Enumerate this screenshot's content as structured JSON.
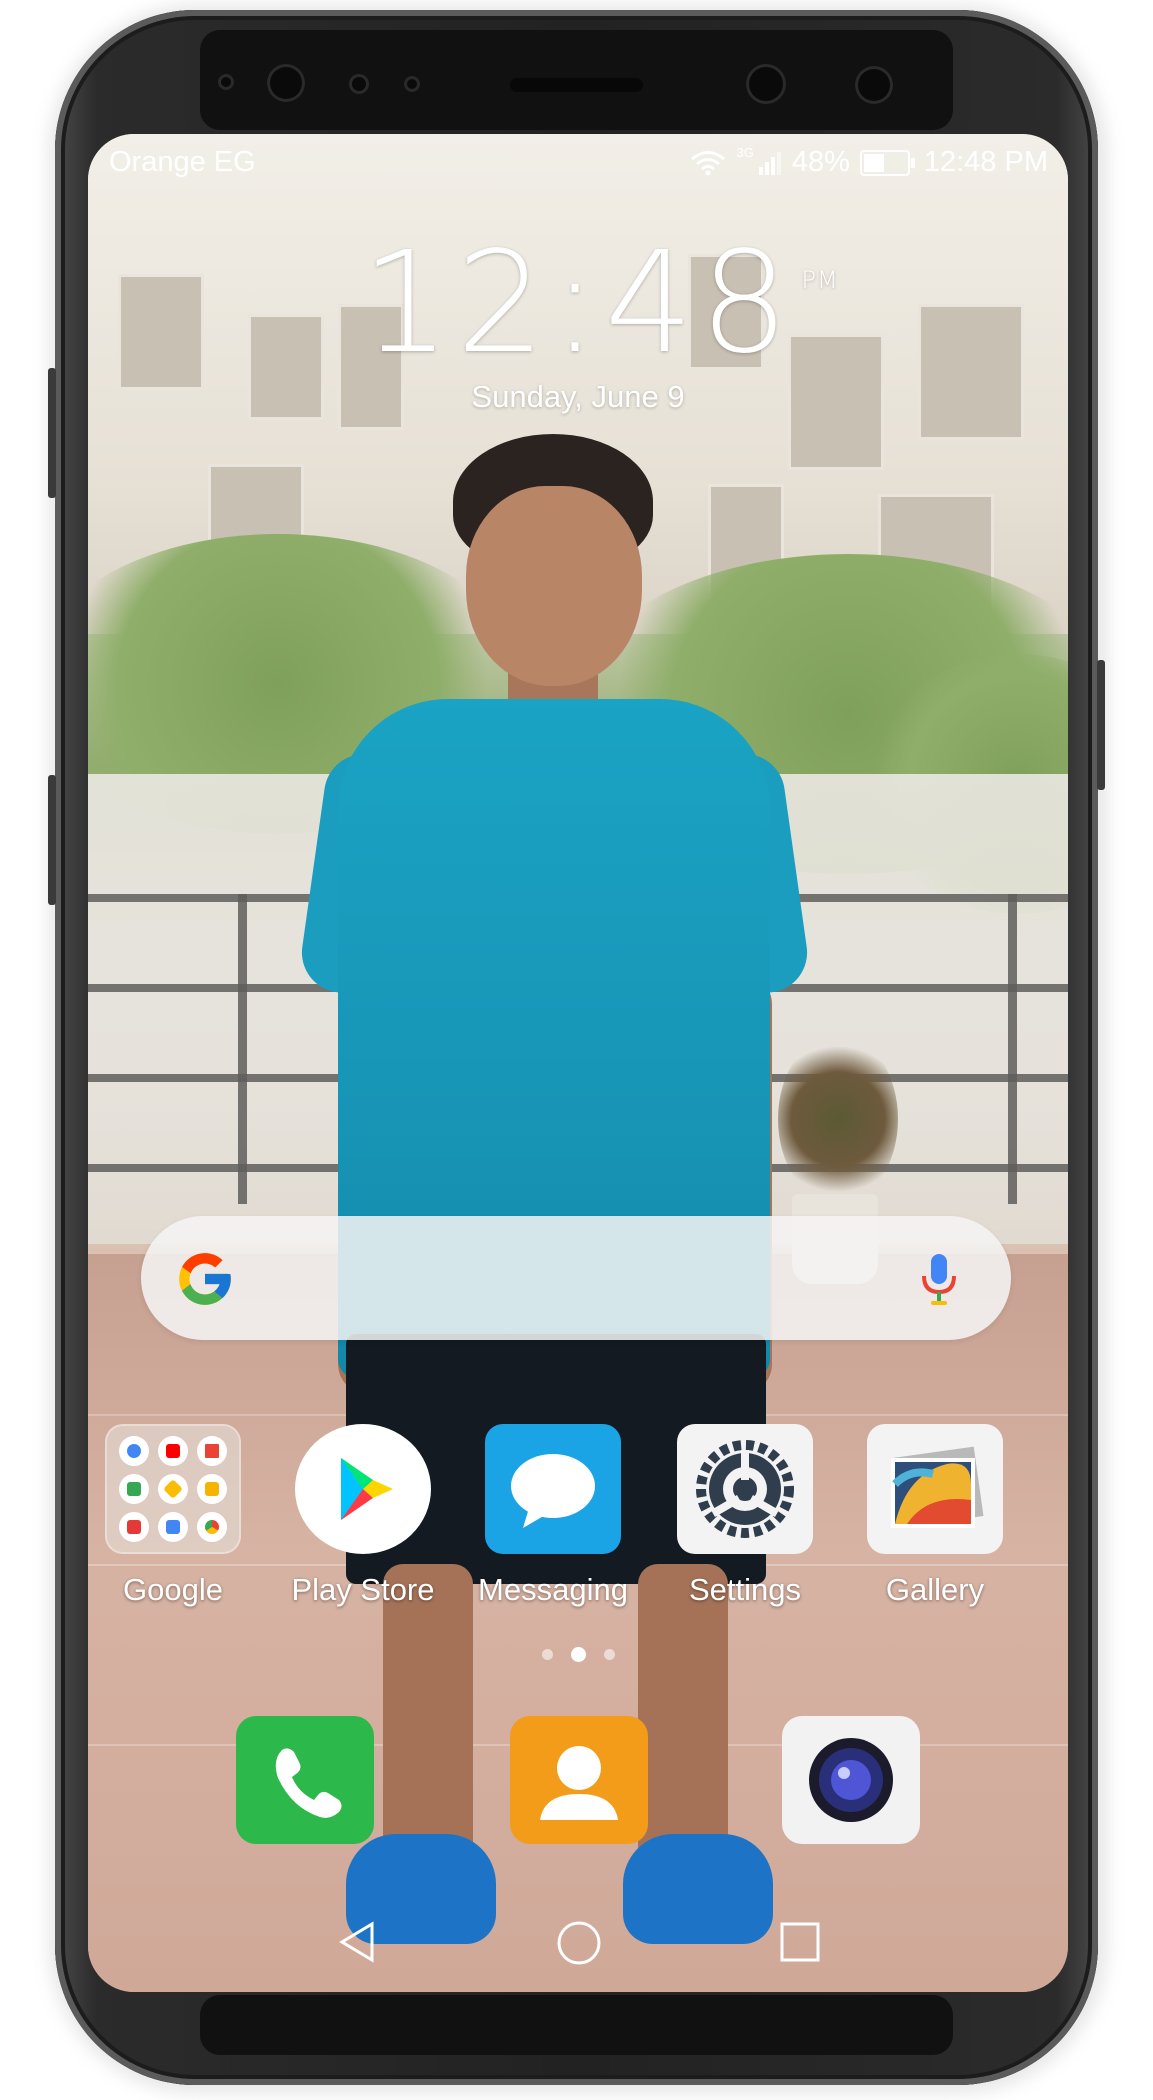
{
  "status_bar": {
    "carrier": "Orange EG",
    "network": "3G",
    "battery": "48%",
    "battery_level": 0.48,
    "time": "12:48 PM"
  },
  "lock_clock": {
    "time": "12:48",
    "ampm": "PM",
    "date": "Sunday, June 9"
  },
  "search_bar": {
    "logo_icon": "google-g-icon",
    "mic_icon": "microphone-icon"
  },
  "apps": [
    {
      "label": "Google",
      "icon": "google-folder-icon"
    },
    {
      "label": "Play Store",
      "icon": "play-store-icon"
    },
    {
      "label": "Messaging",
      "icon": "messaging-icon"
    },
    {
      "label": "Settings",
      "icon": "settings-gear-icon"
    },
    {
      "label": "Gallery",
      "icon": "gallery-icon"
    }
  ],
  "page_indicator": {
    "pages": 3,
    "current": 2
  },
  "dock": [
    {
      "icon": "phone-icon",
      "color": "#2cb84b"
    },
    {
      "icon": "contacts-icon",
      "color": "#f39c1a"
    },
    {
      "icon": "camera-icon",
      "color": "#f2f2f2"
    }
  ],
  "colors": {
    "messaging": "#1aa4e5",
    "phone": "#2cb84b",
    "contacts": "#f39c1a"
  }
}
